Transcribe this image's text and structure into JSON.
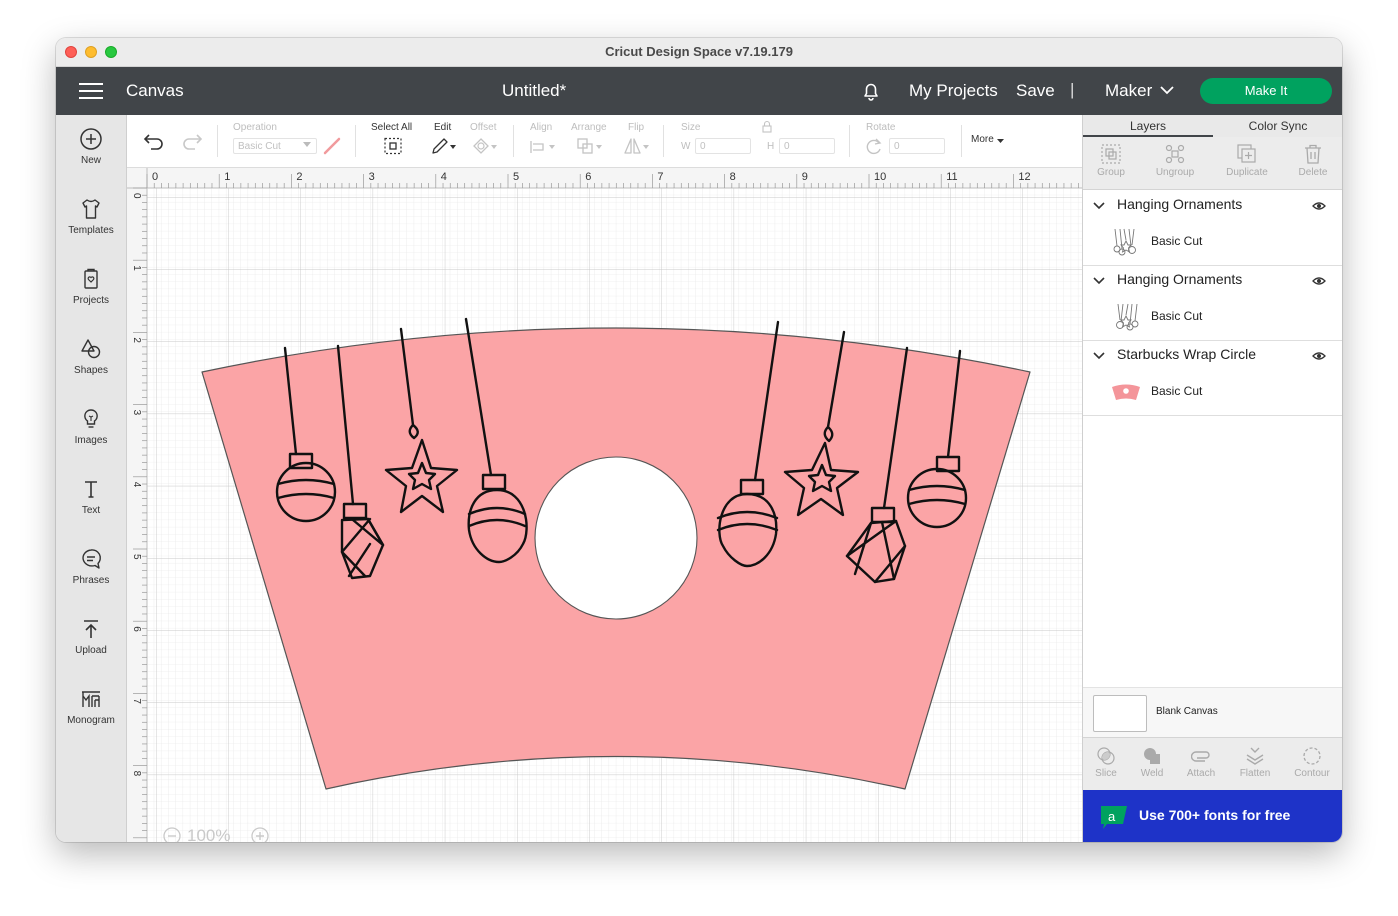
{
  "window": {
    "title": "Cricut Design Space  v7.19.179"
  },
  "header": {
    "section": "Canvas",
    "document": "Untitled*",
    "my_projects": "My Projects",
    "save": "Save",
    "separator": "|",
    "machine": "Maker",
    "make_it": "Make It"
  },
  "sidebar": {
    "items": [
      {
        "label": "New",
        "icon": "plus-circle-icon"
      },
      {
        "label": "Templates",
        "icon": "tshirt-icon"
      },
      {
        "label": "Projects",
        "icon": "projects-icon"
      },
      {
        "label": "Shapes",
        "icon": "shapes-icon"
      },
      {
        "label": "Images",
        "icon": "lightbulb-icon"
      },
      {
        "label": "Text",
        "icon": "text-icon"
      },
      {
        "label": "Phrases",
        "icon": "speech-bubble-icon"
      },
      {
        "label": "Upload",
        "icon": "upload-icon"
      },
      {
        "label": "Monogram",
        "icon": "monogram-icon"
      }
    ]
  },
  "toolbar": {
    "operation_label": "Operation",
    "operation_value": "Basic Cut",
    "select_all": "Select All",
    "edit": "Edit",
    "offset": "Offset",
    "align": "Align",
    "arrange": "Arrange",
    "flip": "Flip",
    "size": "Size",
    "w_label": "W",
    "w_value": "0",
    "h_label": "H",
    "h_value": "0",
    "rotate": "Rotate",
    "rotate_value": "0",
    "more": "More"
  },
  "ruler": {
    "top": [
      "0",
      "1",
      "2",
      "3",
      "4",
      "5",
      "6",
      "7",
      "8",
      "9",
      "10",
      "11",
      "12"
    ],
    "left": [
      "0",
      "1",
      "2",
      "3",
      "4",
      "5",
      "6",
      "7",
      "8"
    ]
  },
  "zoom": {
    "minus": "−",
    "value": "100%",
    "plus": "+"
  },
  "panel": {
    "tabs": [
      "Layers",
      "Color Sync"
    ],
    "actions": [
      "Group",
      "Ungroup",
      "Duplicate",
      "Delete"
    ],
    "layers": [
      {
        "name": "Hanging Ornaments",
        "sub": "Basic Cut"
      },
      {
        "name": "Hanging Ornaments",
        "sub": "Basic Cut"
      },
      {
        "name": "Starbucks Wrap Circle",
        "sub": "Basic Cut"
      }
    ],
    "blank_canvas": "Blank Canvas",
    "bottom_actions": [
      "Slice",
      "Weld",
      "Attach",
      "Flatten",
      "Contour"
    ],
    "promo": "Use 700+ fonts for free"
  },
  "colors": {
    "header_bg": "#414549",
    "make_it": "#00a25f",
    "wrap_fill": "#fba4a6",
    "promo_bg": "#1e33c8"
  }
}
